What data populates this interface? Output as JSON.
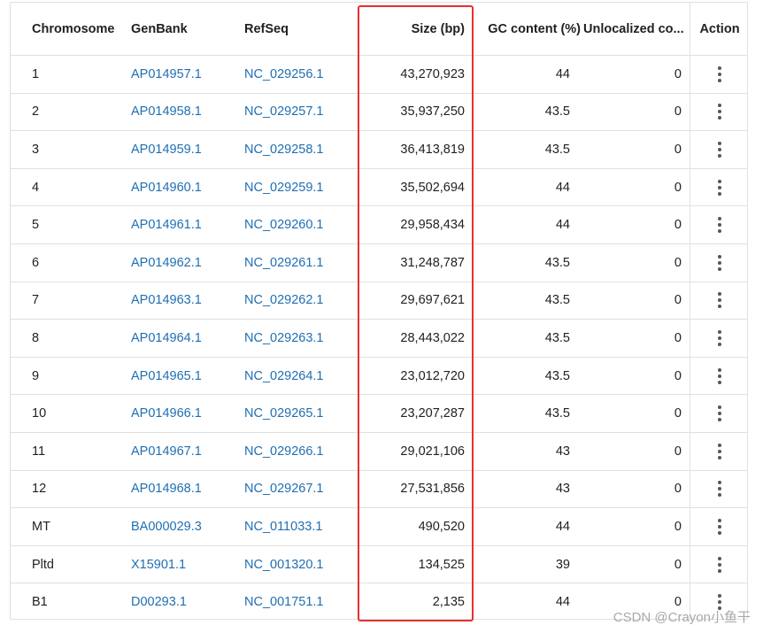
{
  "table": {
    "headers": {
      "chromosome": "Chromosome",
      "genbank": "GenBank",
      "refseq": "RefSeq",
      "size": "Size (bp)",
      "gc": "GC content (%)",
      "unlocalized": "Unlocalized co...",
      "action": "Action"
    },
    "rows": [
      {
        "chromosome": "1",
        "genbank": "AP014957.1",
        "refseq": "NC_029256.1",
        "size": "43,270,923",
        "gc": "44",
        "unlocalized": "0"
      },
      {
        "chromosome": "2",
        "genbank": "AP014958.1",
        "refseq": "NC_029257.1",
        "size": "35,937,250",
        "gc": "43.5",
        "unlocalized": "0"
      },
      {
        "chromosome": "3",
        "genbank": "AP014959.1",
        "refseq": "NC_029258.1",
        "size": "36,413,819",
        "gc": "43.5",
        "unlocalized": "0"
      },
      {
        "chromosome": "4",
        "genbank": "AP014960.1",
        "refseq": "NC_029259.1",
        "size": "35,502,694",
        "gc": "44",
        "unlocalized": "0"
      },
      {
        "chromosome": "5",
        "genbank": "AP014961.1",
        "refseq": "NC_029260.1",
        "size": "29,958,434",
        "gc": "44",
        "unlocalized": "0"
      },
      {
        "chromosome": "6",
        "genbank": "AP014962.1",
        "refseq": "NC_029261.1",
        "size": "31,248,787",
        "gc": "43.5",
        "unlocalized": "0"
      },
      {
        "chromosome": "7",
        "genbank": "AP014963.1",
        "refseq": "NC_029262.1",
        "size": "29,697,621",
        "gc": "43.5",
        "unlocalized": "0"
      },
      {
        "chromosome": "8",
        "genbank": "AP014964.1",
        "refseq": "NC_029263.1",
        "size": "28,443,022",
        "gc": "43.5",
        "unlocalized": "0"
      },
      {
        "chromosome": "9",
        "genbank": "AP014965.1",
        "refseq": "NC_029264.1",
        "size": "23,012,720",
        "gc": "43.5",
        "unlocalized": "0"
      },
      {
        "chromosome": "10",
        "genbank": "AP014966.1",
        "refseq": "NC_029265.1",
        "size": "23,207,287",
        "gc": "43.5",
        "unlocalized": "0"
      },
      {
        "chromosome": "11",
        "genbank": "AP014967.1",
        "refseq": "NC_029266.1",
        "size": "29,021,106",
        "gc": "43",
        "unlocalized": "0"
      },
      {
        "chromosome": "12",
        "genbank": "AP014968.1",
        "refseq": "NC_029267.1",
        "size": "27,531,856",
        "gc": "43",
        "unlocalized": "0"
      },
      {
        "chromosome": "MT",
        "genbank": "BA000029.3",
        "refseq": "NC_011033.1",
        "size": "490,520",
        "gc": "44",
        "unlocalized": "0"
      },
      {
        "chromosome": "Pltd",
        "genbank": "X15901.1",
        "refseq": "NC_001320.1",
        "size": "134,525",
        "gc": "39",
        "unlocalized": "0"
      },
      {
        "chromosome": "B1",
        "genbank": "D00293.1",
        "refseq": "NC_001751.1",
        "size": "2,135",
        "gc": "44",
        "unlocalized": "0"
      }
    ]
  },
  "icons": {
    "row_action": "more-vertical-icon"
  },
  "colors": {
    "link": "#1f6fb2",
    "highlight": "#e8302f"
  },
  "watermark": "CSDN @Crayon小鱼干"
}
